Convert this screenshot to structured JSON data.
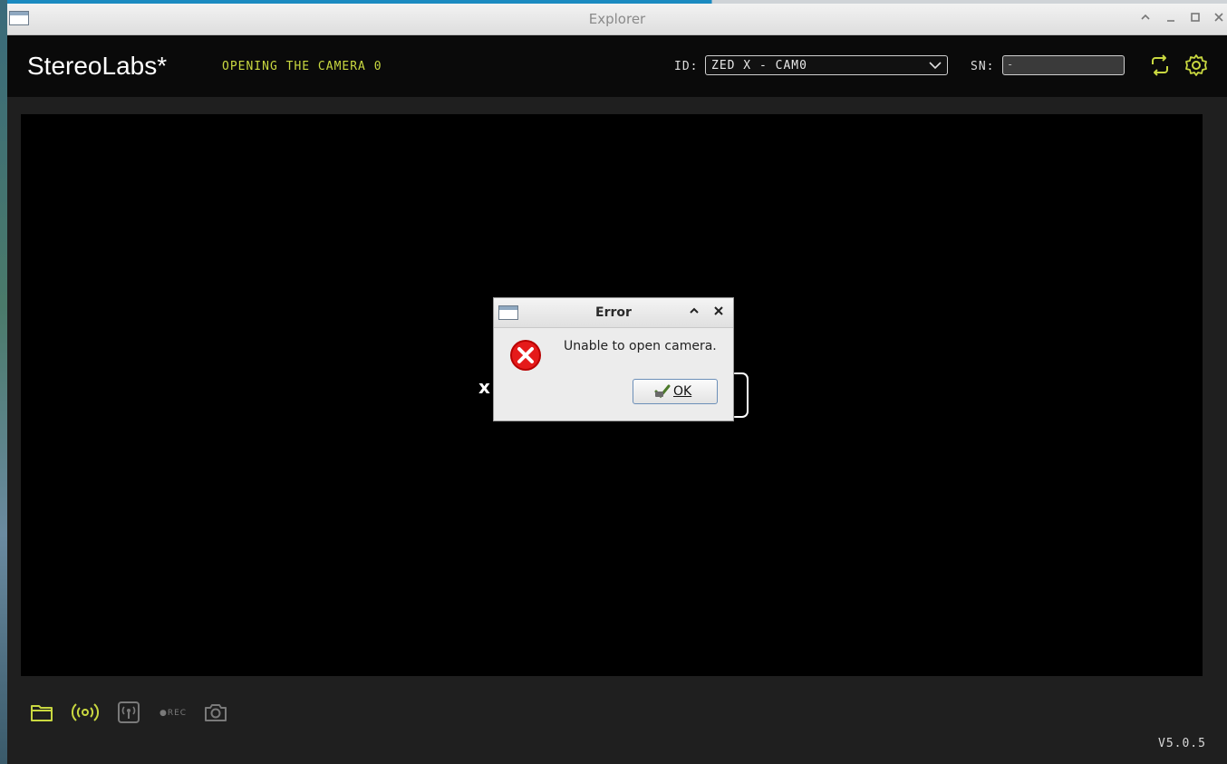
{
  "window": {
    "title": "Explorer",
    "controls": [
      "chevron-up-icon",
      "minimize-icon",
      "maximize-icon",
      "close-icon"
    ]
  },
  "header": {
    "brand": "StereoLabs*",
    "status": "OPENING THE CAMERA 0",
    "id_label": "ID:",
    "camera_select": {
      "value": "ZED X - CAM0"
    },
    "sn_label": "SN:",
    "sn_value": "-",
    "icons": [
      "refresh-icon",
      "settings-gear-icon"
    ],
    "accent_color": "#c9d840"
  },
  "viewport": {
    "loader_fragment": "x"
  },
  "dialog": {
    "title": "Error",
    "message": "Unable to open camera.",
    "ok_label": "OK",
    "icon": "error-icon"
  },
  "toolbar": {
    "icons": [
      "folder-icon",
      "live-stream-icon",
      "network-stream-icon",
      "record-icon",
      "camera-snapshot-icon"
    ],
    "rec_label": "●REC"
  },
  "footer": {
    "version": "V5.0.5"
  }
}
